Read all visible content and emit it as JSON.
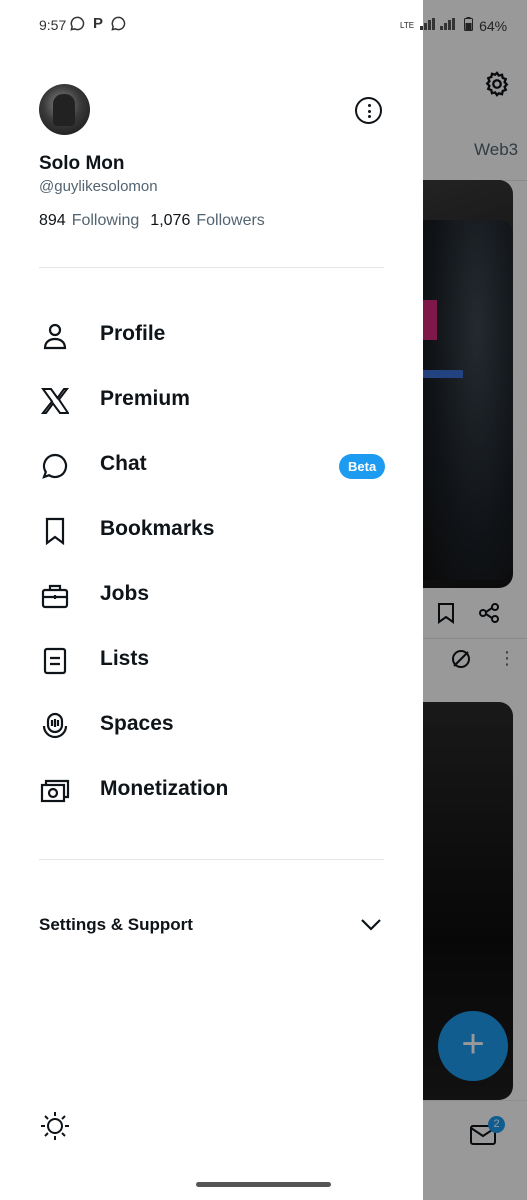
{
  "status_bar": {
    "time": "9:57",
    "left_icons": [
      "whatsapp-icon",
      "p-icon",
      "whatsapp-icon"
    ],
    "network": "LTE",
    "battery": "64%"
  },
  "background": {
    "tab_label": "Web3",
    "mail_badge_count": "2"
  },
  "profile": {
    "name": "Solo Mon",
    "handle": "@guylikesolomon",
    "following_count": "894",
    "following_label": "Following",
    "followers_count": "1,076",
    "followers_label": "Followers"
  },
  "menu": [
    {
      "label": "Profile",
      "icon": "person-icon"
    },
    {
      "label": "Premium",
      "icon": "x-logo-icon"
    },
    {
      "label": "Chat",
      "icon": "chat-bubble-icon",
      "badge": "Beta"
    },
    {
      "label": "Bookmarks",
      "icon": "bookmark-icon"
    },
    {
      "label": "Jobs",
      "icon": "briefcase-icon"
    },
    {
      "label": "Lists",
      "icon": "list-icon"
    },
    {
      "label": "Spaces",
      "icon": "spaces-icon"
    },
    {
      "label": "Monetization",
      "icon": "money-icon"
    }
  ],
  "settings_support": "Settings & Support",
  "colors": {
    "accent": "#1d9bf0",
    "text": "#0f1419",
    "secondary": "#536471"
  }
}
